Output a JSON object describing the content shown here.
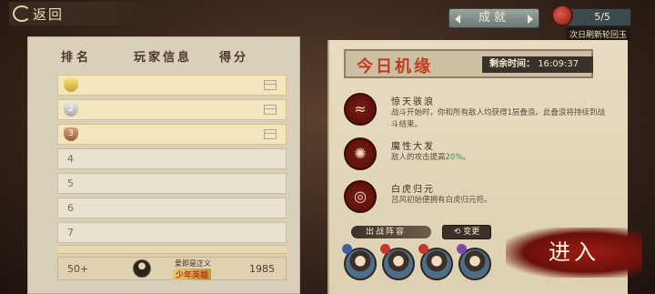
{
  "topbar": {
    "back_label": "返回",
    "achievement_label": "成就",
    "jade_count": "5/5",
    "jade_note": "次日刷新轮回玉"
  },
  "leaderboard": {
    "headers": {
      "rank": "排名",
      "player": "玩家信息",
      "score": "得分"
    },
    "rows": [
      {
        "rank": "1",
        "medal": "gold"
      },
      {
        "rank": "2",
        "medal": "silver"
      },
      {
        "rank": "3",
        "medal": "bronze"
      },
      {
        "rank": "4"
      },
      {
        "rank": "5"
      },
      {
        "rank": "6"
      },
      {
        "rank": "7"
      }
    ],
    "self": {
      "rank": "50+",
      "name": "爱即是正义",
      "title": "少年英雄",
      "score": "1985"
    }
  },
  "chance": {
    "title": "今日机缘",
    "timer_label": "剩余时间：",
    "timer_value": "16:09:37",
    "buffs": [
      {
        "name": "惊天骇浪",
        "desc": "战斗开始时，你和所有敌人均获得1层叠浪。此叠浪将持续到战斗结束。",
        "icon": "wave-icon"
      },
      {
        "name": "魔性大发",
        "desc_prefix": "敌人的攻击提高",
        "desc_value": "20%",
        "desc_suffix": "。",
        "icon": "flame-icon"
      },
      {
        "name": "白虎归元",
        "desc": "吕风初始便拥有白虎归元符。",
        "icon": "tiger-icon"
      }
    ],
    "lineup_label": "出战阵容",
    "change_label": "变更",
    "heroes": [
      {
        "name": "hero-1",
        "badge_color": "#3d5fa3"
      },
      {
        "name": "hero-2",
        "badge_color": "#c0392b"
      },
      {
        "name": "hero-3",
        "badge_color": "#c0392b"
      },
      {
        "name": "hero-4",
        "badge_color": "#7a4aa8"
      }
    ]
  },
  "enter_label": "进入"
}
